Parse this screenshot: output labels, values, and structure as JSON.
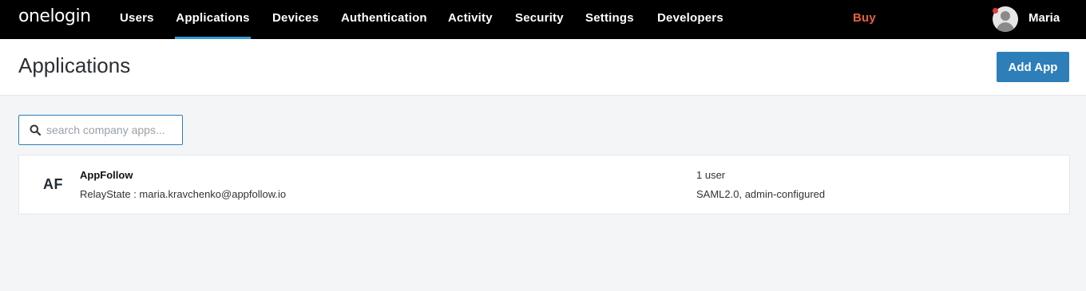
{
  "nav": {
    "logo": "onelogin",
    "items": [
      {
        "label": "Users"
      },
      {
        "label": "Applications",
        "active": true
      },
      {
        "label": "Devices"
      },
      {
        "label": "Authentication"
      },
      {
        "label": "Activity"
      },
      {
        "label": "Security"
      },
      {
        "label": "Settings"
      },
      {
        "label": "Developers"
      }
    ],
    "buy_label": "Buy",
    "user": {
      "name": "Maria",
      "avatar_icon": "user-avatar-icon",
      "has_notification": true
    }
  },
  "header": {
    "title": "Applications",
    "add_app_label": "Add App"
  },
  "search": {
    "placeholder": "search company apps...",
    "value": "",
    "icon": "search-icon"
  },
  "apps": [
    {
      "abbr": "AF",
      "name": "AppFollow",
      "relay_state": "RelayState : maria.kravchenko@appfollow.io",
      "users": "1 user",
      "config": "SAML2.0, admin-configured"
    }
  ],
  "colors": {
    "nav_bg": "#000000",
    "active_underline": "#2f9bd6",
    "buy": "#e8603c",
    "primary_button": "#2d7eb9",
    "page_bg": "#f4f5f7"
  }
}
